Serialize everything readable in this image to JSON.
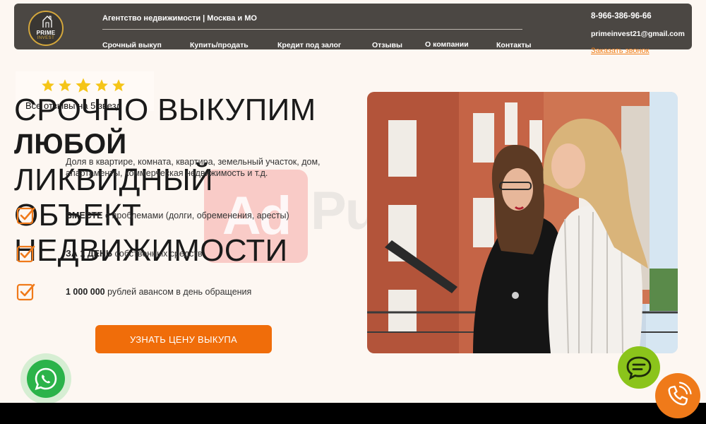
{
  "header": {
    "logo_line1": "PRIME",
    "logo_line2": "INVEST",
    "tagline": "Агентство недвижимости | Москва и МО",
    "nav": [
      "Срочный выкуп",
      "Купить/продать",
      "Кредит под залог",
      "Отзывы",
      "О компании",
      "Контакты"
    ],
    "phone": "8-966-386-96-66",
    "email": "primeinvest21@gmail.com",
    "callback_link": "Заказать звонок"
  },
  "reviews": {
    "stars": 5,
    "text": "Все отзывы на 5 звезд"
  },
  "hero": {
    "line1": "СРОЧНО ВЫКУПИМ",
    "line2": "ЛЮБОЙ",
    "line3": "ЛИКВИДНЫЙ",
    "line4": "ОБЪЕКТ",
    "line5": "НЕДВИЖИМОСТИ",
    "subtitle": "Доля в квартире, комната, квартира, земельный участок, дом, апартаменты, коммерческая недвижимость и т.д."
  },
  "features": [
    {
      "bold": "ВМЕСТЕ",
      "text": " с проблемами (долги, обременения, аресты)"
    },
    {
      "bold": "ЗА 1 ДЕНЬ",
      "text": " собственных средств"
    },
    {
      "bold": "1 000 000",
      "text": " рублей авансом в день обращения"
    }
  ],
  "cta_label": "УЗНАТЬ ЦЕНУ ВЫКУПА",
  "ad_watermark": {
    "part1": "Ad",
    "part2": "Pump"
  },
  "colors": {
    "accent": "#f06d0a",
    "header_bg": "#4b4743",
    "page_bg": "#fdf7f2",
    "whatsapp": "#2bb34a",
    "chat": "#8bc41b",
    "call": "#ef7a1a",
    "star": "#f5c518"
  },
  "icons": [
    "house-logo-icon",
    "star-icon",
    "checkbox-icon",
    "whatsapp-icon",
    "chat-icon",
    "phone-icon"
  ]
}
